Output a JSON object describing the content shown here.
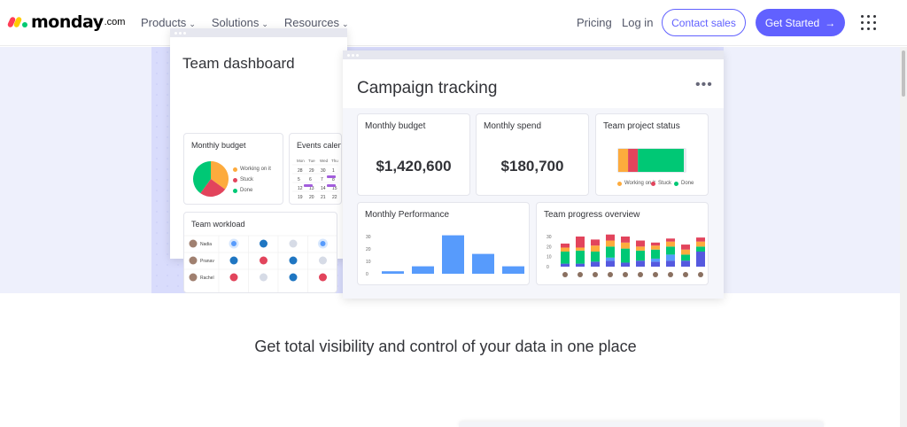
{
  "brand": {
    "name": "monday",
    "suffix": ".com",
    "logo_colors": [
      "#ff3d57",
      "#ffcb00",
      "#00ca72"
    ]
  },
  "nav": {
    "menu": [
      {
        "label": "Products",
        "icon": "chevron-down-icon"
      },
      {
        "label": "Solutions",
        "icon": "chevron-down-icon"
      },
      {
        "label": "Resources",
        "icon": "chevron-down-icon"
      }
    ],
    "pricing": "Pricing",
    "login": "Log in",
    "contact": "Contact sales",
    "get_started": "Get Started",
    "get_started_icon": "arrow-right-icon",
    "apps_icon": "grid-menu-icon"
  },
  "colors": {
    "accent": "#6161ff",
    "working": "#fdab3d",
    "stuck": "#e2445c",
    "done": "#00c875",
    "blue": "#579bfc",
    "purple": "#5559df"
  },
  "team_dashboard": {
    "title": "Team dashboard",
    "monthly_budget": {
      "title": "Monthly budget",
      "legend": [
        "Working on it",
        "Stuck",
        "Done"
      ],
      "slices": [
        {
          "label": "Working on it",
          "value": 35,
          "color": "#fdab3d"
        },
        {
          "label": "Stuck",
          "value": 25,
          "color": "#e2445c"
        },
        {
          "label": "Done",
          "value": 40,
          "color": "#00c875"
        }
      ]
    },
    "events_calendar": {
      "title": "Events calendar",
      "days": [
        "Mon",
        "Tue",
        "Wed",
        "Thu"
      ],
      "rows": [
        [
          "28",
          "29",
          "30",
          "1"
        ],
        [
          "5",
          "6",
          "7",
          "8"
        ],
        [
          "12",
          "13",
          "14",
          "15"
        ],
        [
          "19",
          "20",
          "21",
          "22"
        ]
      ]
    },
    "workload": {
      "title": "Team workload",
      "rows": [
        {
          "name": "Nadia",
          "cells": [
            "b",
            "bd",
            "g",
            "b",
            "b"
          ]
        },
        {
          "name": "Pranav",
          "cells": [
            "bd",
            "r",
            "bd",
            "g",
            "g"
          ]
        },
        {
          "name": "Rachel",
          "cells": [
            "r",
            "g",
            "bd",
            "r",
            "g"
          ]
        }
      ]
    }
  },
  "campaign": {
    "title": "Campaign tracking",
    "more_icon": "more-dots-icon",
    "monthly_budget": {
      "title": "Monthly budget",
      "value": "$1,420,600"
    },
    "monthly_spend": {
      "title": "Monthly spend",
      "value": "$180,700"
    },
    "team_project_status": {
      "title": "Team project status",
      "legend": [
        "Working on it",
        "Stuck",
        "Done"
      ],
      "bar": [
        {
          "label": "Working on it",
          "value": 15,
          "color": "#fdab3d"
        },
        {
          "label": "Stuck",
          "value": 15,
          "color": "#e2445c"
        },
        {
          "label": "Done",
          "value": 70,
          "color": "#00c875"
        }
      ]
    },
    "monthly_performance": {
      "title": "Monthly Performance",
      "y_ticks": [
        "30",
        "20",
        "10",
        "0"
      ],
      "ylim": [
        0,
        30
      ],
      "values": [
        2,
        6,
        31,
        16,
        6
      ]
    },
    "team_progress": {
      "title": "Team progress overview",
      "y_ticks": [
        "30",
        "20",
        "10",
        "0"
      ],
      "ylim": [
        0,
        30
      ],
      "stack_colors": [
        "#5559df",
        "#579bfc",
        "#00c875",
        "#fdab3d",
        "#e2445c"
      ],
      "stacks": [
        [
          3,
          0,
          12,
          4,
          4
        ],
        [
          3,
          0,
          13,
          3,
          11
        ],
        [
          5,
          0,
          10,
          6,
          6
        ],
        [
          6,
          3,
          11,
          6,
          6
        ],
        [
          4,
          0,
          14,
          6,
          6
        ],
        [
          6,
          0,
          10,
          4,
          6
        ],
        [
          5,
          3,
          9,
          4,
          3
        ],
        [
          6,
          6,
          8,
          5,
          3
        ],
        [
          6,
          0,
          6,
          5,
          5
        ],
        [
          15,
          0,
          5,
          5,
          4
        ]
      ]
    }
  },
  "headline": "Get total visibility and control of your data in one place"
}
